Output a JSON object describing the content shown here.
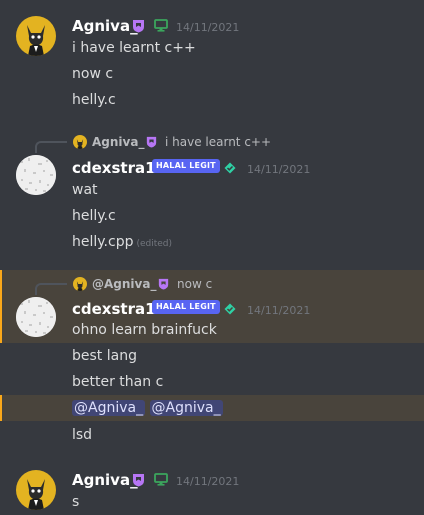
{
  "colors": {
    "background": "#36393f",
    "mention_highlight": "#49443c",
    "mention_bar": "#faa81a",
    "tag": "#5865f2",
    "timestamp": "#72767d",
    "text": "#dcddde",
    "subscriber_badge": "#b776f5",
    "online_monitor": "#3ba55d",
    "verified_check": "#2ed1a5"
  },
  "icons": {
    "subscriber_badge": "subscriber-shield-icon",
    "platform": "desktop-monitor-icon",
    "verified": "verified-check-icon"
  },
  "group1": {
    "username": "Agniva_",
    "timestamp": "14/11/2021",
    "messages": [
      "i have learnt c++",
      "now c",
      "helly.c"
    ]
  },
  "group2": {
    "reply": {
      "author": "Agniva_",
      "text": "i have learnt c++"
    },
    "username": "cdexstra111",
    "tag": "HALAL LEGIT",
    "timestamp": "14/11/2021",
    "messages": [
      "wat",
      "helly.c",
      "helly.cpp"
    ],
    "edited_label": "(edited)"
  },
  "group3": {
    "reply": {
      "author": "@Agniva_",
      "text": "now c"
    },
    "username": "cdexstra111",
    "tag": "HALAL LEGIT",
    "timestamp": "14/11/2021",
    "messages": [
      "ohno learn brainfuck",
      "best lang",
      "better than c"
    ],
    "mentions": [
      "@Agniva_",
      "@Agniva_"
    ],
    "last_message": "lsd"
  },
  "group4": {
    "username": "Agniva_",
    "timestamp": "14/11/2021",
    "messages": [
      "s"
    ]
  }
}
